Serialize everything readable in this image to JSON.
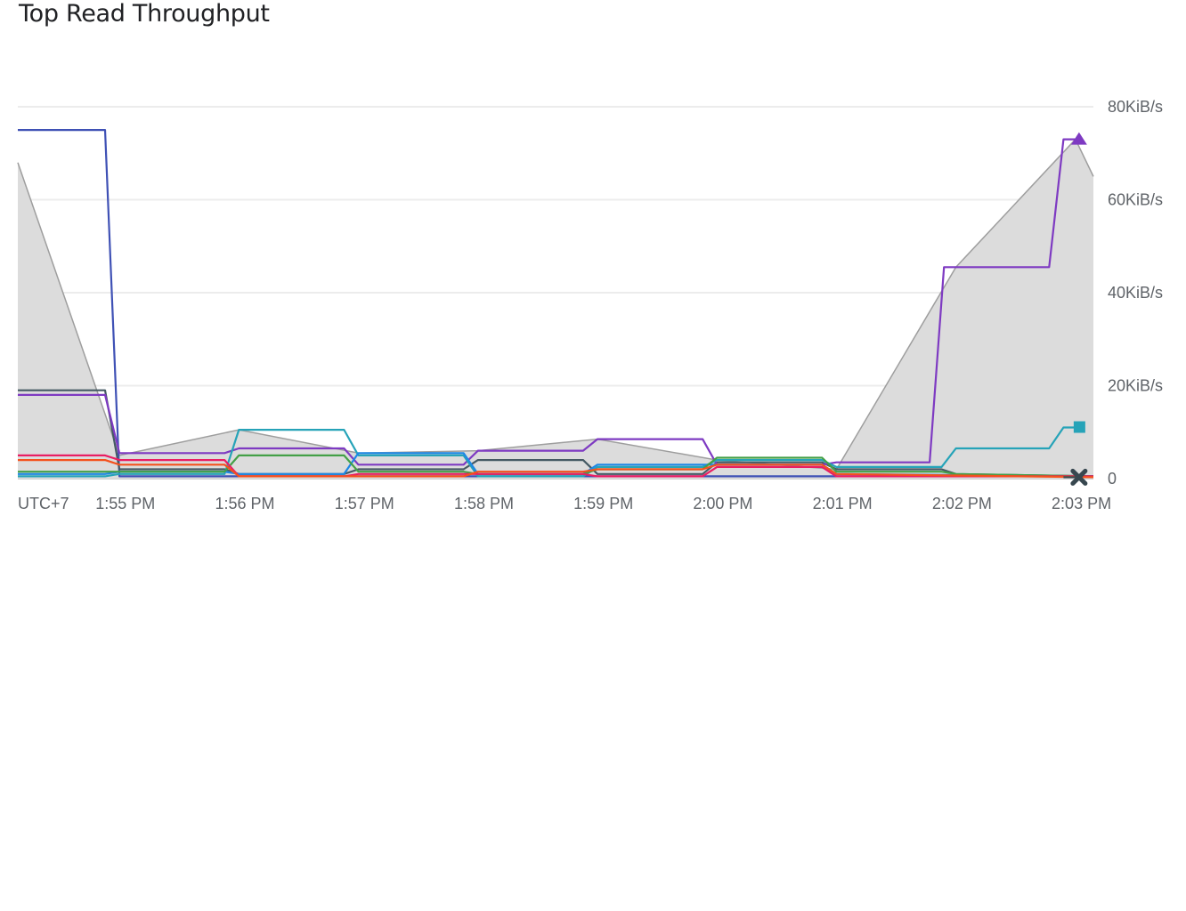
{
  "title": "Top Read Throughput",
  "chart_data": {
    "type": "line",
    "timezone_label": "UTC+7",
    "x_ticks": [
      "1:55 PM",
      "1:56 PM",
      "1:57 PM",
      "1:58 PM",
      "1:59 PM",
      "2:00 PM",
      "2:01 PM",
      "2:02 PM",
      "2:03 PM"
    ],
    "y_ticks": [
      {
        "value": 0,
        "label": "0"
      },
      {
        "value": 20,
        "label": "20KiB/s"
      },
      {
        "value": 40,
        "label": "40KiB/s"
      },
      {
        "value": 60,
        "label": "60KiB/s"
      },
      {
        "value": 80,
        "label": "80KiB/s"
      }
    ],
    "x_unit": "minutes",
    "xlim": [
      54.1,
      63.1
    ],
    "ylim": [
      0,
      80
    ],
    "grid": true,
    "background_area": {
      "color": "#dcdcdc",
      "stroke": "#9e9e9e",
      "x": [
        54.1,
        54.95,
        55.95,
        56.95,
        57.95,
        58.95,
        59.95,
        60.95,
        61.95,
        62.95,
        63.1
      ],
      "y": [
        68,
        5,
        10.5,
        5.5,
        6,
        8.5,
        4,
        2,
        45.5,
        73,
        65
      ]
    },
    "series": [
      {
        "color": "#3f51b5",
        "x": [
          54.1,
          54.83,
          54.95,
          63.1
        ],
        "y": [
          75,
          75,
          0.5,
          0.5
        ]
      },
      {
        "color": "#455a64",
        "x": [
          54.1,
          54.83,
          54.95,
          55.83,
          55.95,
          56.83,
          56.95,
          57.83,
          57.95,
          58.83,
          58.95,
          59.83,
          59.95,
          60.83,
          60.95,
          61.83,
          61.95,
          63.1
        ],
        "y": [
          19,
          19,
          2,
          2,
          1,
          1,
          2,
          2,
          4,
          4,
          1,
          1,
          3.5,
          3.5,
          2,
          2,
          1,
          0.5
        ]
      },
      {
        "color": "#7e3ac2",
        "marker": "triangle",
        "x": [
          54.1,
          54.83,
          54.95,
          55.83,
          55.95,
          56.83,
          56.95,
          57.83,
          57.95,
          58.83,
          58.95,
          59.83,
          59.95,
          60.83,
          60.95,
          61.73,
          61.85,
          62.73,
          62.85,
          62.95
        ],
        "y": [
          18,
          18,
          5.5,
          5.5,
          6.5,
          6.5,
          3,
          3,
          6,
          6,
          8.5,
          8.5,
          3,
          3,
          3.5,
          3.5,
          45.5,
          45.5,
          73,
          73
        ]
      },
      {
        "color": "#26a3b8",
        "marker": "square",
        "x": [
          54.1,
          54.83,
          54.95,
          55.83,
          55.95,
          56.83,
          56.95,
          57.83,
          57.95,
          58.83,
          58.95,
          59.83,
          59.95,
          60.83,
          60.95,
          61.83,
          61.95,
          62.73,
          62.85,
          62.95
        ],
        "y": [
          0.5,
          0.5,
          1,
          1,
          10.5,
          10.5,
          5,
          5,
          0.5,
          0.5,
          2.5,
          2.5,
          4,
          4,
          2.5,
          2.5,
          6.5,
          6.5,
          11,
          11
        ]
      },
      {
        "color": "#1e88e5",
        "x": [
          54.1,
          54.83,
          54.95,
          55.83,
          55.95,
          56.83,
          56.95,
          57.83,
          57.95,
          58.83,
          58.95,
          59.83,
          59.95,
          60.83,
          60.95,
          63.1
        ],
        "y": [
          1,
          1,
          1.5,
          1.5,
          1,
          1,
          5.5,
          5.5,
          1,
          1,
          3,
          3,
          3,
          3,
          1,
          0.5
        ]
      },
      {
        "color": "#43a047",
        "x": [
          54.1,
          54.83,
          54.95,
          55.83,
          55.95,
          56.83,
          56.95,
          57.83,
          57.95,
          58.83,
          58.95,
          59.83,
          59.95,
          60.83,
          60.95,
          61.83,
          61.95,
          63.1
        ],
        "y": [
          1.5,
          1.5,
          1.5,
          1.5,
          5,
          5,
          1.5,
          1.5,
          1,
          1,
          2,
          2,
          4.5,
          4.5,
          1.5,
          1.5,
          1,
          0.5
        ]
      },
      {
        "color": "#e91e63",
        "x": [
          54.1,
          54.83,
          54.95,
          55.83,
          55.95,
          56.83,
          56.95,
          57.83,
          57.95,
          58.83,
          58.95,
          59.83,
          59.95,
          60.83,
          60.95,
          63.1
        ],
        "y": [
          5,
          5,
          4,
          4,
          0.5,
          0.5,
          1,
          1,
          1,
          1,
          0.5,
          0.5,
          2.5,
          2.5,
          0.5,
          0.5
        ]
      },
      {
        "color": "#f4511e",
        "x": [
          54.1,
          54.83,
          54.95,
          55.83,
          55.95,
          56.83,
          56.95,
          57.83,
          57.95,
          58.83,
          58.95,
          59.83,
          59.95,
          60.83,
          60.95,
          63.1
        ],
        "y": [
          4,
          4,
          3,
          3,
          0.5,
          0.5,
          0.5,
          0.5,
          1.5,
          1.5,
          2,
          2,
          3,
          3,
          1,
          0.3
        ]
      },
      {
        "color": "#37474f",
        "marker": "x",
        "x": [
          62.85,
          62.95
        ],
        "y": [
          0.3,
          0.3
        ]
      }
    ]
  }
}
